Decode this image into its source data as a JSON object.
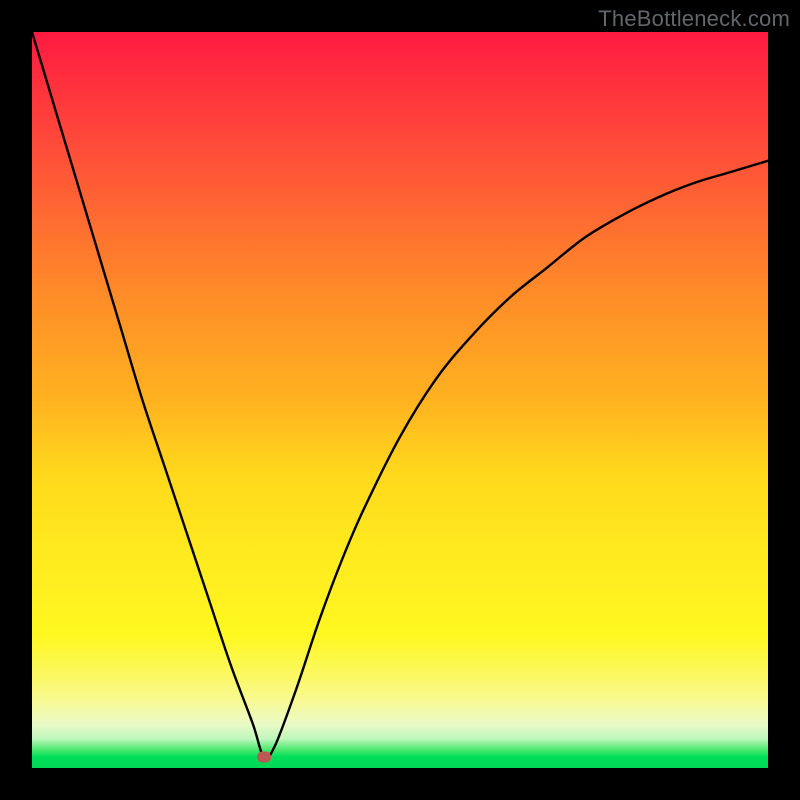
{
  "watermark": "TheBottleneck.com",
  "chart_data": {
    "type": "line",
    "title": "",
    "xlabel": "",
    "ylabel": "",
    "xlim": [
      0,
      100
    ],
    "ylim": [
      0,
      100
    ],
    "grid": false,
    "axes_visible": false,
    "background_gradient": {
      "direction": "vertical",
      "stops": [
        {
          "pos": 0.0,
          "color": "#ff1a40"
        },
        {
          "pos": 0.15,
          "color": "#ff4a3a"
        },
        {
          "pos": 0.35,
          "color": "#ff8a28"
        },
        {
          "pos": 0.55,
          "color": "#ffc81e"
        },
        {
          "pos": 0.75,
          "color": "#fff020"
        },
        {
          "pos": 0.92,
          "color": "#f0faa8"
        },
        {
          "pos": 0.97,
          "color": "#60ea72"
        },
        {
          "pos": 1.0,
          "color": "#00d856"
        }
      ]
    },
    "series": [
      {
        "name": "curve",
        "x": [
          0,
          3,
          6,
          9,
          12,
          15,
          18,
          21,
          24,
          27,
          30,
          31.5,
          33,
          36,
          39,
          42,
          45,
          50,
          55,
          60,
          65,
          70,
          75,
          80,
          85,
          90,
          95,
          100
        ],
        "y": [
          100,
          90,
          80,
          70,
          60,
          50,
          41,
          32,
          23,
          14,
          6,
          1.5,
          3,
          11,
          20,
          28,
          35,
          45,
          53,
          59,
          64,
          68,
          72,
          75,
          77.5,
          79.5,
          81,
          82.5
        ],
        "color": "#000000",
        "marker_index": 11
      }
    ],
    "annotations": []
  }
}
